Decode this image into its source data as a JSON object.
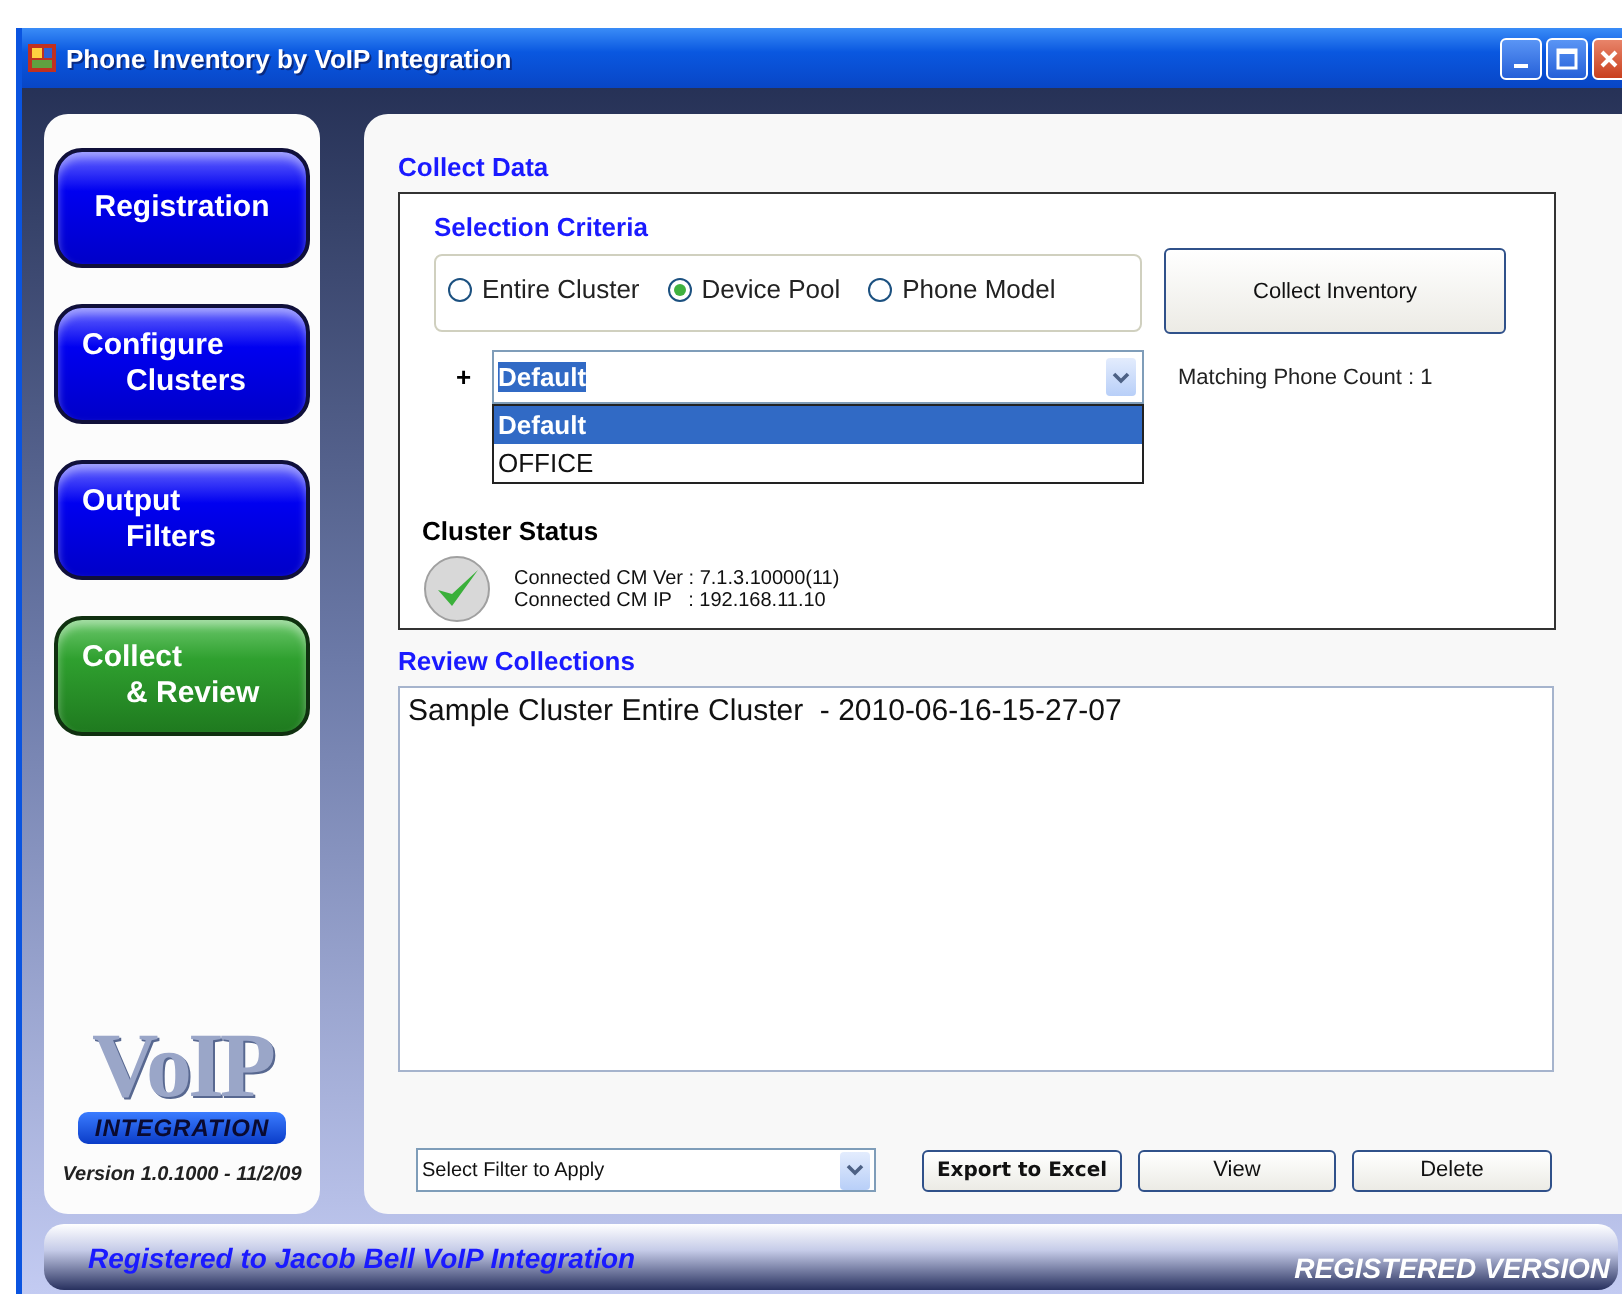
{
  "window": {
    "title": "Phone Inventory by VoIP Integration"
  },
  "nav": [
    {
      "lines": [
        "Registration"
      ],
      "selected": false
    },
    {
      "lines": [
        "Configure",
        "Clusters"
      ],
      "selected": false
    },
    {
      "lines": [
        "Output",
        "Filters"
      ],
      "selected": false
    },
    {
      "lines": [
        "Collect",
        "& Review"
      ],
      "selected": true
    }
  ],
  "logo": {
    "word": "VoIP",
    "tagline": "INTEGRATION"
  },
  "version": "Version 1.0.1000 - 11/2/09",
  "collect_data": {
    "title": "Collect Data",
    "selection_criteria": {
      "title": "Selection Criteria",
      "options": [
        {
          "label": "Entire Cluster",
          "selected": false
        },
        {
          "label": "Device Pool",
          "selected": true
        },
        {
          "label": "Phone Model",
          "selected": false
        }
      ],
      "collect_button": "Collect Inventory",
      "prefix": "+",
      "dropdown": {
        "value": "Default",
        "expanded": true,
        "items": [
          {
            "label": "Default",
            "selected": true
          },
          {
            "label": "OFFICE",
            "selected": false
          }
        ]
      },
      "matching_count": "Matching Phone Count : 1"
    },
    "cluster_status": {
      "title": "Cluster Status",
      "ok": true,
      "lines": [
        "Connected CM Ver : 7.1.3.10000(11)",
        "Connected CM IP   : 192.168.11.10"
      ]
    }
  },
  "review": {
    "title": "Review Collections",
    "items": [
      "Sample Cluster Entire Cluster  - 2010-06-16-15-27-07"
    ],
    "filter": {
      "value": "Select Filter to Apply"
    },
    "buttons": [
      "Export to Excel",
      "View",
      "Delete"
    ]
  },
  "banner": {
    "left": "Registered to Jacob Bell VoIP Integration",
    "right": "REGISTERED VERSION"
  }
}
